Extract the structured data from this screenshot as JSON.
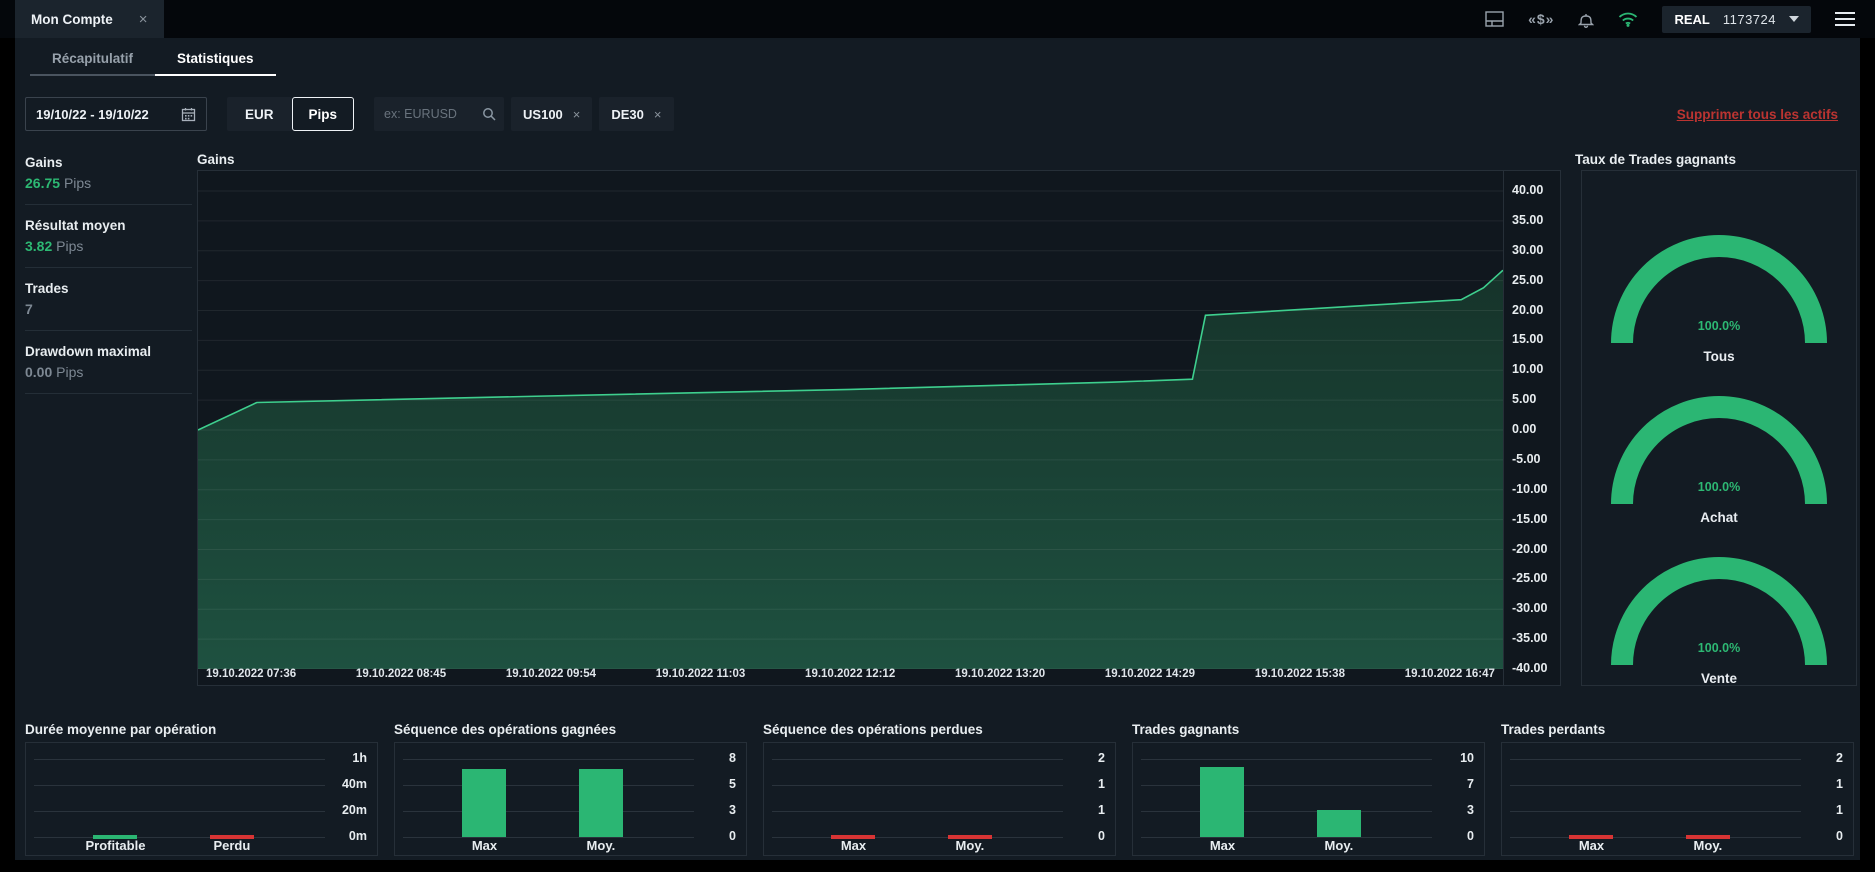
{
  "topbar": {
    "tab_label": "Mon Compte",
    "account_type": "REAL",
    "account_number": "1173724"
  },
  "glyphs": {
    "close": "×",
    "chip_close": "×",
    "cashback": "«$»"
  },
  "tabs": [
    {
      "label": "Récapitulatif",
      "active": false
    },
    {
      "label": "Statistiques",
      "active": true
    }
  ],
  "filters": {
    "date_range": "19/10/22 - 19/10/22",
    "currency_label": "EUR",
    "unit_label": "Pips",
    "search_placeholder": "ex: EURUSD",
    "chips": [
      "US100",
      "DE30"
    ],
    "clear_all": "Supprimer tous les actifs"
  },
  "summary": [
    {
      "title": "Gains",
      "value": "26.75",
      "unit": "Pips",
      "highlight": true
    },
    {
      "title": "Résultat moyen",
      "value": "3.82",
      "unit": "Pips",
      "highlight": true
    },
    {
      "title": "Trades",
      "value": "7",
      "unit": "",
      "highlight": false
    },
    {
      "title": "Drawdown maximal",
      "value": "0.00",
      "unit": "Pips",
      "highlight": false
    }
  ],
  "colors": {
    "green": "#2bb673",
    "green_line": "#3ecf8e",
    "green_text": "#2db873",
    "red": "#d83434",
    "link_red": "#bb3431",
    "fill_top": "#16332a",
    "fill_bottom": "#1e5140"
  },
  "chart_data": [
    {
      "id": "gains",
      "type": "area",
      "title": "Gains",
      "unit": "Pips",
      "ylim": [
        -40,
        40
      ],
      "ytick_step": 5,
      "final_value": 26.75,
      "x_labels": [
        "19.10.2022 07:36",
        "19.10.2022 08:45",
        "19.10.2022 09:54",
        "19.10.2022 11:03",
        "19.10.2022 12:12",
        "19.10.2022 13:20",
        "19.10.2022 14:29",
        "19.10.2022 15:38",
        "19.10.2022 16:47"
      ],
      "points": [
        {
          "x": 0.0,
          "y": 0.0
        },
        {
          "x": 0.045,
          "y": 4.6
        },
        {
          "x": 0.25,
          "y": 5.6
        },
        {
          "x": 0.5,
          "y": 6.8
        },
        {
          "x": 0.7,
          "y": 8.0
        },
        {
          "x": 0.762,
          "y": 8.5
        },
        {
          "x": 0.772,
          "y": 19.2
        },
        {
          "x": 0.9,
          "y": 20.9
        },
        {
          "x": 0.968,
          "y": 21.8
        },
        {
          "x": 0.985,
          "y": 23.8
        },
        {
          "x": 1.0,
          "y": 26.75
        }
      ]
    },
    {
      "id": "win_rate",
      "type": "gauge",
      "title": "Taux de Trades gagnants",
      "gauges": [
        {
          "label": "Tous",
          "value": 100.0,
          "display": "100.0%"
        },
        {
          "label": "Achat",
          "value": 100.0,
          "display": "100.0%"
        },
        {
          "label": "Vente",
          "value": 100.0,
          "display": "100.0%"
        }
      ]
    },
    {
      "id": "avg_duration",
      "type": "bar",
      "title": "Durée moyenne par opération",
      "yticks": [
        "1h",
        "40m",
        "20m",
        "0m"
      ],
      "ymax": 60,
      "unit": "minutes",
      "categories": [
        "Profitable",
        "Perdu"
      ],
      "values": [
        0,
        0
      ],
      "colors": [
        "green",
        "red"
      ]
    },
    {
      "id": "win_streak",
      "type": "bar",
      "title": "Séquence des opérations gagnées",
      "yticks": [
        "8",
        "5",
        "3",
        "0"
      ],
      "ymax": 8,
      "categories": [
        "Max",
        "Moy."
      ],
      "values": [
        7,
        7
      ],
      "colors": [
        "green",
        "green"
      ]
    },
    {
      "id": "loss_streak",
      "type": "bar",
      "title": "Séquence des opérations perdues",
      "yticks": [
        "2",
        "1",
        "1",
        "0"
      ],
      "ymax": 2,
      "categories": [
        "Max",
        "Moy."
      ],
      "values": [
        0,
        0
      ],
      "colors": [
        "red",
        "red"
      ]
    },
    {
      "id": "winning_trades",
      "type": "bar",
      "title": "Trades gagnants",
      "yticks": [
        "10",
        "7",
        "3",
        "0"
      ],
      "ymax": 10,
      "categories": [
        "Max",
        "Moy."
      ],
      "values": [
        9,
        3.5
      ],
      "colors": [
        "green",
        "green"
      ]
    },
    {
      "id": "losing_trades",
      "type": "bar",
      "title": "Trades perdants",
      "yticks": [
        "2",
        "1",
        "1",
        "0"
      ],
      "ymax": 2,
      "categories": [
        "Max",
        "Moy."
      ],
      "values": [
        0,
        0
      ],
      "colors": [
        "red",
        "red"
      ]
    }
  ]
}
